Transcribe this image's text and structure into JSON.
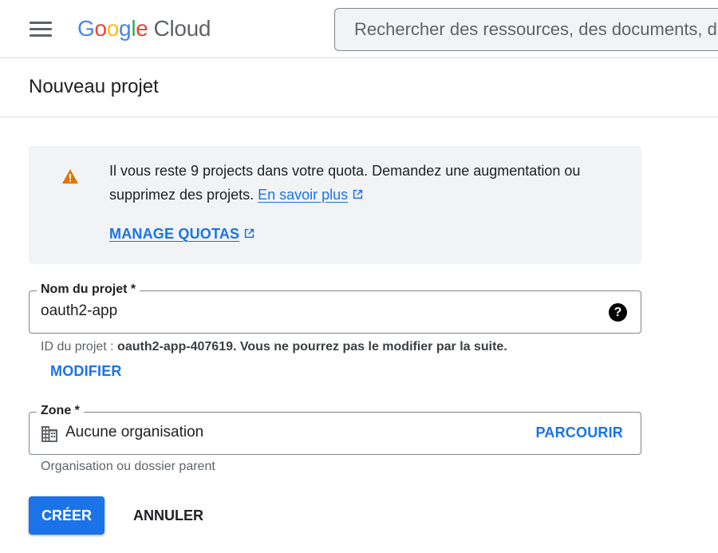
{
  "header": {
    "logo_letters": [
      "G",
      "o",
      "o",
      "g",
      "l",
      "e"
    ],
    "logo_product": "Cloud",
    "search_placeholder": "Rechercher des ressources, des documents, d"
  },
  "page": {
    "title": "Nouveau projet"
  },
  "quota_banner": {
    "message": "Il vous reste 9 projects dans votre quota. Demandez une augmentation ou supprimez des projets.",
    "learn_more": "En savoir plus",
    "manage_quotas": "MANAGE QUOTAS",
    "icon": "warning-icon"
  },
  "project_name": {
    "label": "Nom du projet *",
    "value": "oauth2-app",
    "help_glyph": "?",
    "id_prefix": "ID du projet : ",
    "id_value": "oauth2-app-407619",
    "id_suffix": ". Vous ne pourrez pas le modifier par la suite.",
    "modify_label": "MODIFIER"
  },
  "zone": {
    "label": "Zone *",
    "value": "Aucune organisation",
    "browse_label": "PARCOURIR",
    "hint": "Organisation ou dossier parent",
    "icon": "building-icon"
  },
  "actions": {
    "create_label": "CRÉER",
    "cancel_label": "ANNULER"
  },
  "colors": {
    "accent": "#1a73e8",
    "warning": "#e37400",
    "banner_bg": "#f1f3f4"
  }
}
